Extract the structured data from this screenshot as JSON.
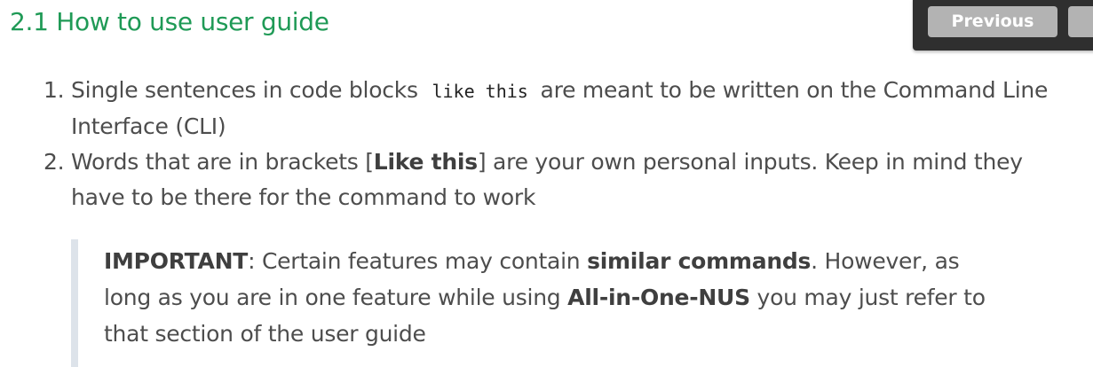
{
  "heading": "2.1 How to use user guide",
  "nav": {
    "previous_label": "Previous",
    "next_label": ""
  },
  "steps": [
    {
      "line1_pre": "Single sentences in code blocks",
      "line1_code": "like this",
      "line1_post": "are meant to be written on the Command Line",
      "line2": "Interface (CLI)"
    },
    {
      "line1_pre": "Words that are in brackets [",
      "line1_bold": "Like this",
      "line1_post": "] are your own personal inputs. Keep in mind they",
      "line2": "have to be there for the command to work"
    }
  ],
  "callout": {
    "label": "IMPORTANT",
    "text1": ": Certain features may contain ",
    "bold1": "similar commands",
    "text2": ". However, as",
    "text3": "long as you are in one feature while using ",
    "bold2": "All-in-One-NUS",
    "text4": " you may just refer to",
    "text5": "that section of the user guide"
  }
}
